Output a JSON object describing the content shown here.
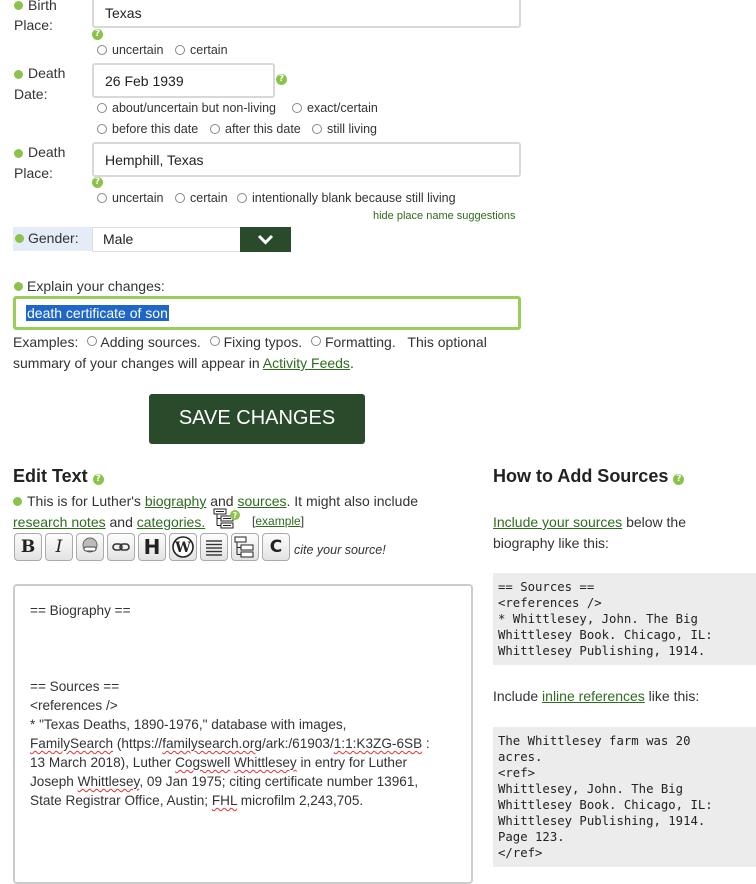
{
  "birth_place": {
    "label_1": "Birth",
    "label_2": "Place:",
    "value": "Texas",
    "options": [
      "uncertain",
      "certain"
    ]
  },
  "death_date": {
    "label_1": "Death",
    "label_2": "Date:",
    "value": "26 Feb 1939",
    "options_row1": [
      "about/uncertain but non-living",
      "exact/certain"
    ],
    "options_row2": [
      "before this date",
      "after this date",
      "still living"
    ]
  },
  "death_place": {
    "label_1": "Death",
    "label_2": "Place:",
    "value": "Hemphill, Texas",
    "options": [
      "uncertain",
      "certain",
      "intentionally blank because still living"
    ],
    "hide_suggestions": "hide place name suggestions"
  },
  "gender": {
    "label": "Gender:",
    "value": "Male"
  },
  "explain": {
    "label": "Explain your changes:",
    "value": "death certificate of son",
    "examples_label": "Examples:",
    "examples": [
      "Adding sources.",
      "Fixing typos.",
      "Formatting."
    ],
    "note_1": "This optional",
    "note_2": "summary of your changes will appear in",
    "note_link": "Activity Feeds",
    "note_end": "."
  },
  "save_button": "SAVE CHANGES",
  "edit_text": {
    "title": "Edit Text",
    "intro_1": "This is for Luther's",
    "link_biography": "biography",
    "and_1": "and",
    "link_sources": "sources",
    "intro_2": ". It might also include",
    "link_research": "research notes",
    "and_2": "and",
    "link_categories": "categories.",
    "example_open": "[",
    "link_example": "example",
    "example_close": "]",
    "cite": "cite your source!",
    "toolbar": [
      "B",
      "I",
      "",
      "",
      "H",
      "W",
      "",
      "",
      "C"
    ]
  },
  "editor": {
    "biography_heading": "== Biography ==",
    "sources_heading": "== Sources ==",
    "references_tag": "<references />",
    "citation_1": "* \"Texas Deaths, 1890-1976,\" database with images,",
    "citation_2a": "FamilySearch",
    "citation_2b": " (https://",
    "citation_2c": "familysearch.org",
    "citation_2d": "/ark:/61903/",
    "citation_2e": "1:1:K3ZG-6SB",
    "citation_2f": " :",
    "citation_3a": "13 March 2018), Luther ",
    "citation_3b": "Cogswell",
    "citation_3c": " ",
    "citation_3d": "Whittlesey",
    "citation_3e": " in entry for Luther",
    "citation_4a": "Joseph ",
    "citation_4b": "Whittlesey",
    "citation_4c": ", 09 Jan 1975; citing certificate number 13961,",
    "citation_5a": "State Registrar Office, Austin; ",
    "citation_5b": "FHL",
    "citation_5c": " microfilm 2,243,705."
  },
  "how_to": {
    "title": "How to Add Sources",
    "link_include": "Include your sources",
    "text_1": " below the",
    "text_2": "biography like this:",
    "code_1": "== Sources ==\n<references />\n* Whittlesey, John. The Big\nWhittlesey Book. Chicago, IL:\nWhittlesey Publishing, 1914.",
    "inline_pre": "Include ",
    "link_inline": "inline references",
    "inline_post": " like this:",
    "code_2": "The Whittlesey farm was 20\nacres.\n<ref>\nWhittlesey, John. The Big\nWhittlesey Book. Chicago, IL:\nWhittlesey Publishing, 1914.\nPage 123.\n</ref>"
  },
  "colors": {
    "accent": "#8bc34a",
    "button": "#2a4a2c",
    "link": "#2e6b1f"
  }
}
